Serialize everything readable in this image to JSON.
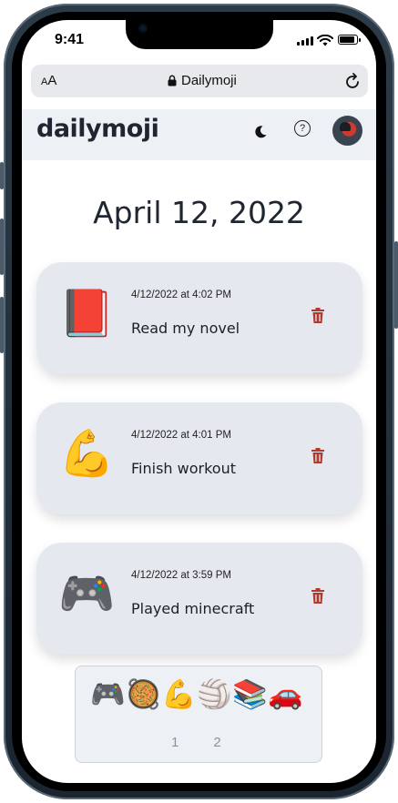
{
  "status": {
    "time": "9:41"
  },
  "browser": {
    "text_size_small": "A",
    "text_size_large": "A",
    "url": "Dailymoji"
  },
  "app": {
    "logo": "dailymoji"
  },
  "date_title": "April 12, 2022",
  "entries": [
    {
      "emoji": "📕",
      "timestamp": "4/12/2022 at 4:02 PM",
      "task": "Read my novel"
    },
    {
      "emoji": "💪",
      "timestamp": "4/12/2022 at 4:01 PM",
      "task": "Finish workout"
    },
    {
      "emoji": "🎮",
      "timestamp": "4/12/2022 at 3:59 PM",
      "task": "Played minecraft"
    }
  ],
  "picker": {
    "emojis": [
      "🎮",
      "🥘",
      "💪",
      "🏐",
      "📚",
      "🚗"
    ],
    "pages": [
      "1",
      "2"
    ]
  },
  "colors": {
    "trash": "#b03a2e",
    "card_bg": "#e5e9ef",
    "header_bg": "#edf0f4"
  }
}
